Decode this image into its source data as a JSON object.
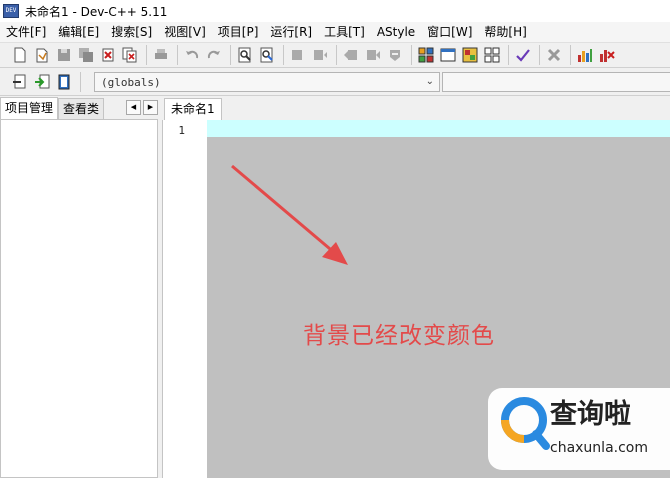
{
  "window": {
    "title": "未命名1 - Dev-C++ 5.11",
    "icon_label": "DEV"
  },
  "menu": [
    "文件[F]",
    "编辑[E]",
    "搜索[S]",
    "视图[V]",
    "项目[P]",
    "运行[R]",
    "工具[T]",
    "AStyle",
    "窗口[W]",
    "帮助[H]"
  ],
  "toolbar2": {
    "scope_value": "(globals)"
  },
  "left_panel": {
    "tabs": [
      "项目管理",
      "查看类"
    ]
  },
  "editor": {
    "tab_label": "未命名1",
    "line_numbers": [
      "1"
    ],
    "background_color": "#c0c0c0",
    "current_line_color": "#ccffff"
  },
  "annotation": {
    "text": "背景已经改变颜色",
    "color": "#e34a4a"
  },
  "watermark": {
    "brand": "查询啦",
    "url": "chaxunla.com"
  }
}
